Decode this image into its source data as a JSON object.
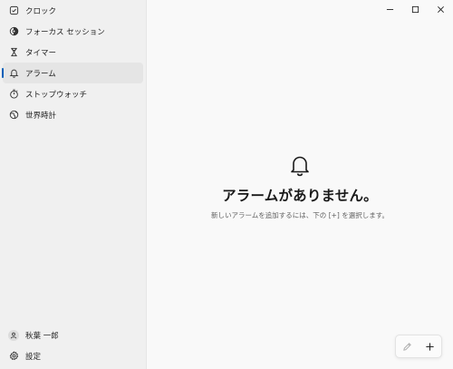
{
  "sidebar": {
    "items": [
      {
        "label": "クロック",
        "icon": "clock-check-icon"
      },
      {
        "label": "フォーカス セッション",
        "icon": "focus-icon"
      },
      {
        "label": "タイマー",
        "icon": "hourglass-icon"
      },
      {
        "label": "アラーム",
        "icon": "bell-icon",
        "active": true
      },
      {
        "label": "ストップウォッチ",
        "icon": "stopwatch-icon"
      },
      {
        "label": "世界時計",
        "icon": "globe-icon"
      }
    ],
    "user": {
      "name": "秋葉 一郎",
      "icon": "user-icon"
    },
    "settings": {
      "label": "設定",
      "icon": "gear-icon"
    }
  },
  "main": {
    "empty_title": "アラームがありません。",
    "empty_subtitle": "新しいアラームを追加するには、下の [+] を選択します。",
    "empty_icon": "bell-icon"
  },
  "colors": {
    "accent": "#005fb8",
    "sidebar_bg": "#f0f0f0",
    "main_bg": "#f9f9f9"
  }
}
